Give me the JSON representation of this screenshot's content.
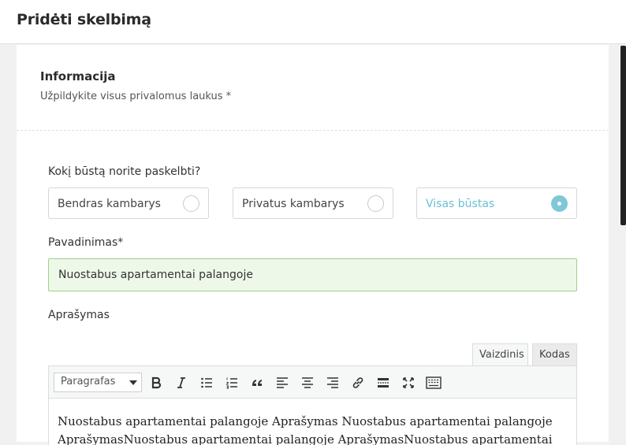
{
  "header": {
    "title": "Pridėti skelbimą"
  },
  "info": {
    "title": "Informacija",
    "subtitle": "Užpildykite visus privalomus laukus *"
  },
  "housing": {
    "question": "Kokį būstą norite paskelbti?",
    "options": [
      {
        "label": "Bendras kambarys",
        "selected": false
      },
      {
        "label": "Privatus kambarys",
        "selected": false
      },
      {
        "label": "Visas būstas",
        "selected": true
      }
    ]
  },
  "name": {
    "label": "Pavadinimas*",
    "value": "Nuostabus apartamentai palangoje"
  },
  "description": {
    "label": "Aprašymas",
    "tabs": [
      "Vaizdinis",
      "Kodas"
    ],
    "format_value": "Paragrafas",
    "toolbar_icons": [
      "bold-icon",
      "italic-icon",
      "bullet-list-icon",
      "numbered-list-icon",
      "blockquote-icon",
      "align-left-icon",
      "align-center-icon",
      "align-right-icon",
      "link-icon",
      "read-more-icon",
      "fullscreen-icon",
      "toolbar-toggle-icon"
    ],
    "text": "Nuostabus apartamentai palangoje Aprašymas Nuostabus apartamentai palangoje AprašymasNuostabus apartamentai palangoje AprašymasNuostabus apartamentai"
  },
  "colors": {
    "accent": "#7ec8d8",
    "success_border": "#9fd18a",
    "success_bg": "#eef8e8"
  }
}
